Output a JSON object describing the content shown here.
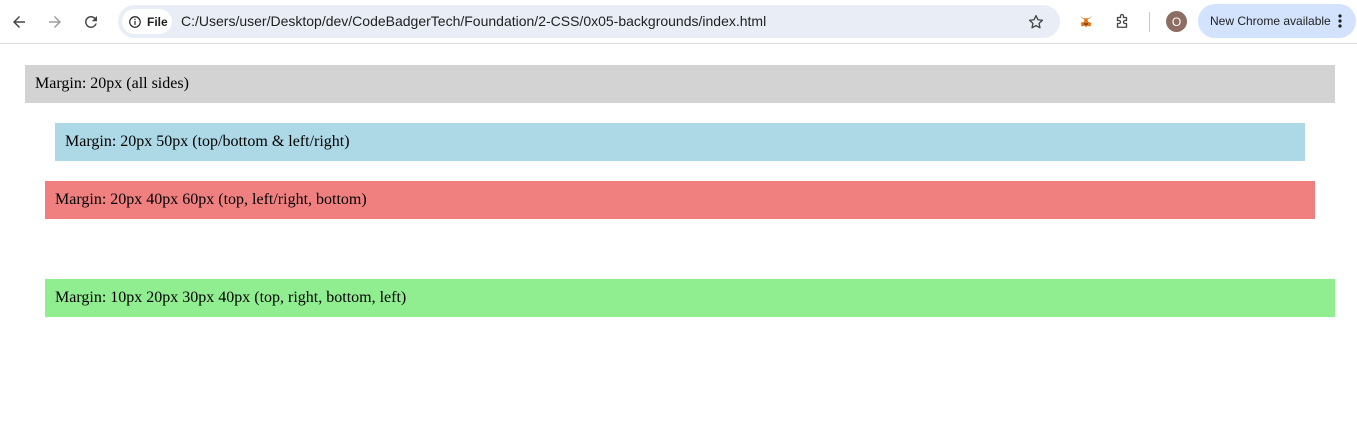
{
  "browser": {
    "site_chip_label": "File",
    "url": "C:/Users/user/Desktop/dev/CodeBadgerTech/Foundation/2-CSS/0x05-backgrounds/index.html",
    "profile_initial": "O",
    "update_label": "New Chrome available",
    "icons": {
      "back": "back-arrow-icon",
      "forward": "forward-arrow-icon",
      "reload": "reload-icon",
      "site_info": "info-icon",
      "bookmark": "star-icon",
      "metamask": "fox-extension-icon",
      "extensions": "puzzle-piece-icon",
      "menu": "three-dots-vertical-icon"
    }
  },
  "page": {
    "boxes": [
      {
        "label": "Margin: 20px (all sides)",
        "color": "#d3d3d3"
      },
      {
        "label": "Margin: 20px 50px (top/bottom & left/right)",
        "color": "#add8e6"
      },
      {
        "label": "Margin: 20px 40px 60px (top, left/right, bottom)",
        "color": "#f08080"
      },
      {
        "label": "Margin: 10px 20px 30px 40px (top, right, bottom, left)",
        "color": "#90ee90"
      }
    ]
  },
  "colors": {
    "omnibox": "#e9eef6",
    "update_pill": "#d3e3fd",
    "avatar": "#8d6e63"
  }
}
